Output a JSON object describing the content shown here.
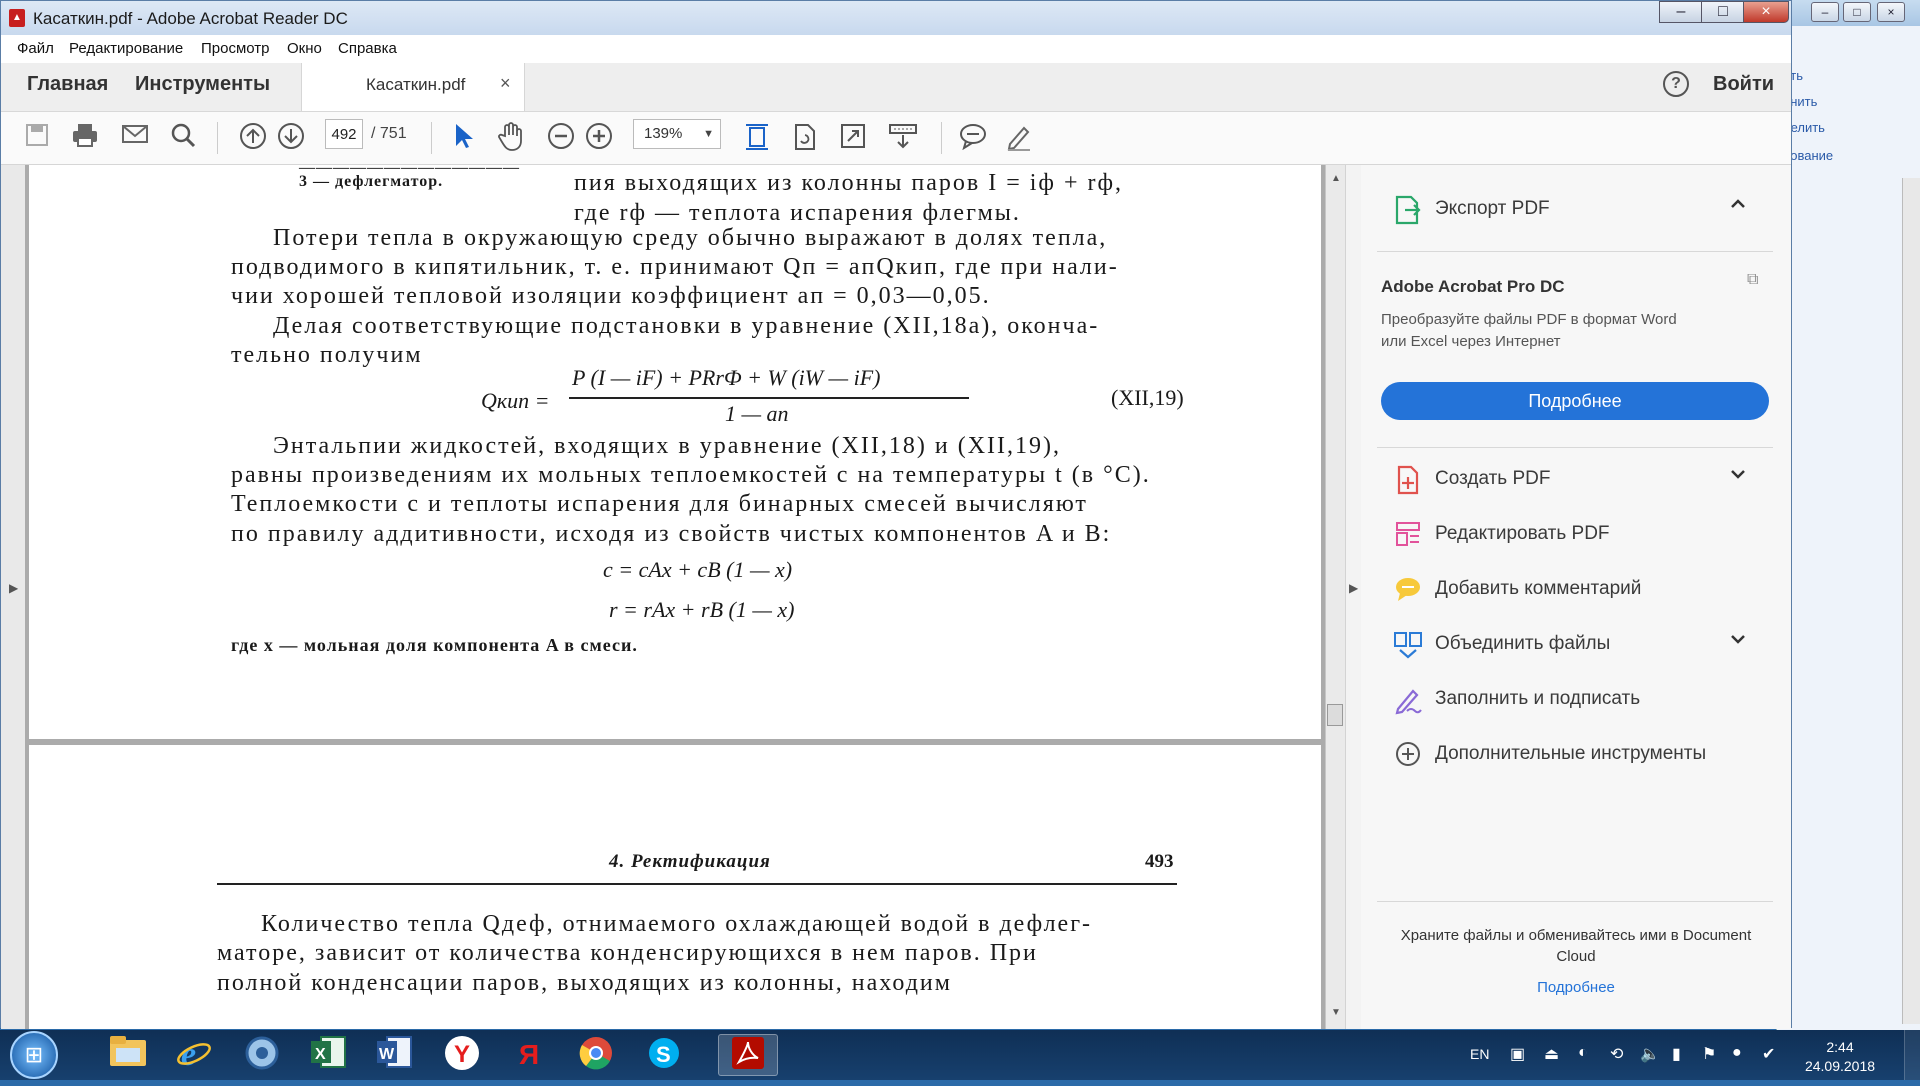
{
  "window": {
    "title": "Касаткин.pdf - Adobe Acrobat Reader DC"
  },
  "menubar": [
    "Файл",
    "Редактирование",
    "Просмотр",
    "Окно",
    "Справка"
  ],
  "tabs": {
    "home": "Главная",
    "tools": "Инструменты",
    "document": "Касаткин.pdf",
    "close": "×"
  },
  "header": {
    "help": "?",
    "login": "Войти"
  },
  "toolbar": {
    "page_current": "492",
    "page_total": "/  751",
    "zoom": "139%"
  },
  "document": {
    "page492_lines": [
      "3 — дефлегматор.",
      "пия  выходящих  из  колонны паров  I = iф + rф,",
      "где  rф — теплота испарения флегмы.",
      "Потери тепла в окружающую среду обычно выражают в долях тепла,",
      "подводимого в кипятильник, т. е. принимают Qп = aпQкип, где  при  нали-",
      "чии хорошей тепловой изоляции коэффициент  aп = 0,03—0,05.",
      "Делая  соответствующие  подстановки  в  уравнение  (XII,18a),  оконча-",
      "тельно  получим",
      "Энтальпии  жидкостей,  входящих  в  уравнение  (XII,18)  и  (XII,19),",
      "равны произведениям их мольных теплоемкостей c на температуры t (в °C).",
      "Теплоемкости  c  и  теплоты  испарения  для  бинарных  смесей  вычисляют",
      "по правилу аддитивности, исходя из свойств чистых компонентов A и B:",
      "где x — мольная доля компонента A в смеси."
    ],
    "eq19_lhs": "Qкип =",
    "eq19_num": "P (I — iF) + PRrФ + W (iW — iF)",
    "eq19_den": "1 — aп",
    "eq19_num_label": "(XII,19)",
    "eq_c": "c = cAx + cB (1 — x)",
    "eq_r": "r = rAx + rB (1 — x)",
    "page493_header": "4. Ректификация",
    "page493_number": "493",
    "page493_lines": [
      "Количество тепла Qдеф, отнимаемого охлаждающей водой в  дефлег-",
      "маторе,  зависит  от  количества  конденсирующихся  в  нем  паров.  При",
      "полной конденсации паров, выходящих из колонны, находим"
    ]
  },
  "right_pane": {
    "export": "Экспорт PDF",
    "promo_title": "Adobe Acrobat Pro DC",
    "promo_desc": "Преобразуйте файлы PDF в формат Word или Excel через Интернет",
    "promo_button": "Подробнее",
    "tools": [
      "Создать PDF",
      "Редактировать PDF",
      "Добавить комментарий",
      "Объединить файлы",
      "Заполнить и подписать",
      "Дополнительные инструменты"
    ],
    "cloud_text": "Храните файлы и обменивайтесь ими в Document Cloud",
    "cloud_link": "Подробнее"
  },
  "background_window": {
    "items": [
      "ить",
      "енить",
      "делить",
      "рование"
    ]
  },
  "taskbar": {
    "lang": "EN",
    "time": "2:44",
    "date": "24.09.2018",
    "icons": [
      "explorer-icon",
      "ie-icon",
      "app-icon",
      "excel-icon",
      "word-icon",
      "yandex-icon",
      "yandex-browser-icon",
      "chrome-icon",
      "skype-icon",
      "acrobat-icon"
    ]
  },
  "colors": {
    "accent": "#2473d8",
    "titlebar": "#c8d9ee",
    "taskbar": "#17406e"
  }
}
